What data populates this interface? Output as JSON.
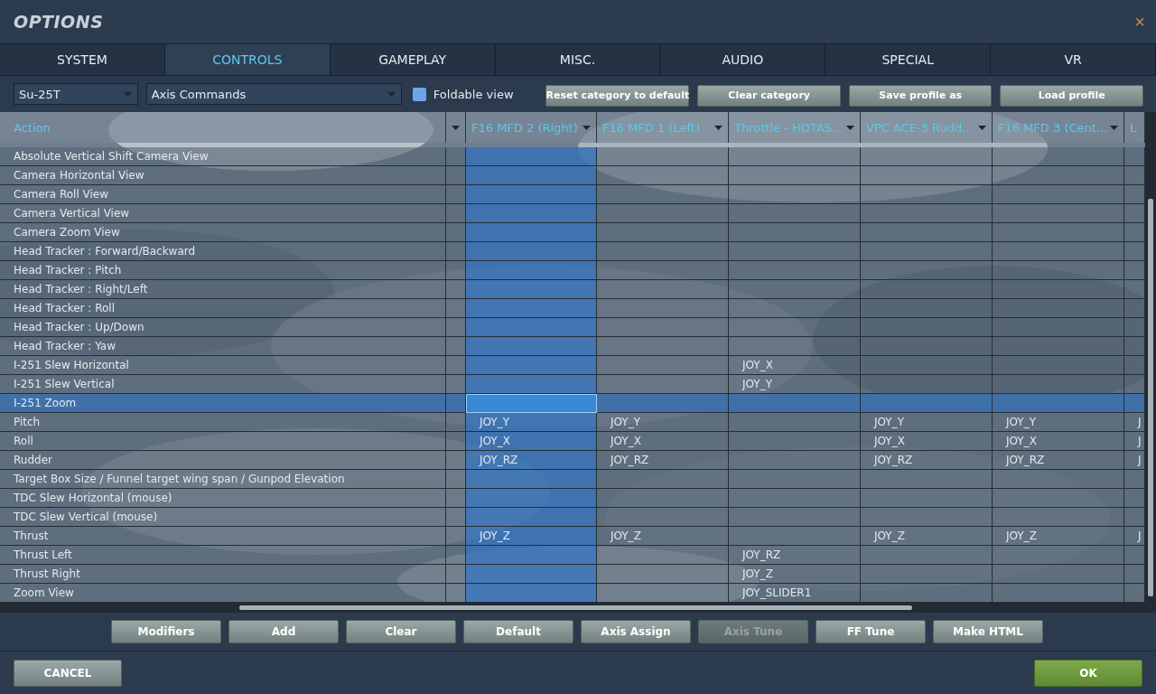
{
  "window": {
    "title": "OPTIONS",
    "close": "×"
  },
  "tabs": [
    {
      "label": "SYSTEM",
      "selected": false
    },
    {
      "label": "CONTROLS",
      "selected": true
    },
    {
      "label": "GAMEPLAY",
      "selected": false
    },
    {
      "label": "MISC.",
      "selected": false
    },
    {
      "label": "AUDIO",
      "selected": false
    },
    {
      "label": "SPECIAL",
      "selected": false
    },
    {
      "label": "VR",
      "selected": false
    }
  ],
  "toolbar": {
    "aircraft": "Su-25T",
    "category": "Axis Commands",
    "foldable_view": {
      "label": "Foldable view",
      "checked": false
    },
    "buttons": [
      "Reset category to default",
      "Clear category",
      "Save profile as",
      "Load profile"
    ]
  },
  "table": {
    "action_header": "Action",
    "columns": [
      {
        "label": "F16 MFD 2 (Right)",
        "selected": true
      },
      {
        "label": "F16 MFD 1 (Left)",
        "selected": false
      },
      {
        "label": "Throttle - HOTAS...",
        "selected": false
      },
      {
        "label": "VPC ACE-3 Rudd...",
        "selected": false
      },
      {
        "label": "F16 MFD 3 (Cent...",
        "selected": false
      },
      {
        "label": "L",
        "selected": false
      }
    ],
    "rows": [
      {
        "action": "Absolute Vertical Shift Camera View",
        "selected": false,
        "cells": [
          null,
          null,
          null,
          null,
          null,
          null
        ]
      },
      {
        "action": "Camera Horizontal View",
        "selected": false,
        "cells": [
          null,
          null,
          null,
          null,
          null,
          null
        ]
      },
      {
        "action": "Camera Roll View",
        "selected": false,
        "cells": [
          null,
          null,
          null,
          null,
          null,
          null
        ]
      },
      {
        "action": "Camera Vertical View",
        "selected": false,
        "cells": [
          null,
          null,
          null,
          null,
          null,
          null
        ]
      },
      {
        "action": "Camera Zoom View",
        "selected": false,
        "cells": [
          null,
          null,
          null,
          null,
          null,
          null
        ]
      },
      {
        "action": "Head Tracker : Forward/Backward",
        "selected": false,
        "cells": [
          null,
          null,
          null,
          null,
          null,
          null
        ]
      },
      {
        "action": "Head Tracker : Pitch",
        "selected": false,
        "cells": [
          null,
          null,
          null,
          null,
          null,
          null
        ]
      },
      {
        "action": "Head Tracker : Right/Left",
        "selected": false,
        "cells": [
          null,
          null,
          null,
          null,
          null,
          null
        ]
      },
      {
        "action": "Head Tracker : Roll",
        "selected": false,
        "cells": [
          null,
          null,
          null,
          null,
          null,
          null
        ]
      },
      {
        "action": "Head Tracker : Up/Down",
        "selected": false,
        "cells": [
          null,
          null,
          null,
          null,
          null,
          null
        ]
      },
      {
        "action": "Head Tracker : Yaw",
        "selected": false,
        "cells": [
          null,
          null,
          null,
          null,
          null,
          null
        ]
      },
      {
        "action": "I-251 Slew Horizontal",
        "selected": false,
        "cells": [
          null,
          null,
          "JOY_X",
          null,
          null,
          null
        ]
      },
      {
        "action": "I-251 Slew Vertical",
        "selected": false,
        "cells": [
          null,
          null,
          "JOY_Y",
          null,
          null,
          null
        ]
      },
      {
        "action": "I-251 Zoom",
        "selected": true,
        "cells": [
          null,
          null,
          null,
          null,
          null,
          null
        ]
      },
      {
        "action": "Pitch",
        "selected": false,
        "cells": [
          "JOY_Y",
          "JOY_Y",
          null,
          "JOY_Y",
          "JOY_Y",
          "J"
        ]
      },
      {
        "action": "Roll",
        "selected": false,
        "cells": [
          "JOY_X",
          "JOY_X",
          null,
          "JOY_X",
          "JOY_X",
          "J"
        ]
      },
      {
        "action": "Rudder",
        "selected": false,
        "cells": [
          "JOY_RZ",
          "JOY_RZ",
          null,
          "JOY_RZ",
          "JOY_RZ",
          "J"
        ]
      },
      {
        "action": "Target Box Size / Funnel target wing span / Gunpod Elevation",
        "selected": false,
        "cells": [
          null,
          null,
          null,
          null,
          null,
          null
        ]
      },
      {
        "action": "TDC Slew Horizontal (mouse)",
        "selected": false,
        "cells": [
          null,
          null,
          null,
          null,
          null,
          null
        ]
      },
      {
        "action": "TDC Slew Vertical (mouse)",
        "selected": false,
        "cells": [
          null,
          null,
          null,
          null,
          null,
          null
        ]
      },
      {
        "action": "Thrust",
        "selected": false,
        "cells": [
          "JOY_Z",
          "JOY_Z",
          null,
          "JOY_Z",
          "JOY_Z",
          "J"
        ]
      },
      {
        "action": "Thrust Left",
        "selected": false,
        "cells": [
          null,
          null,
          "JOY_RZ",
          null,
          null,
          null
        ]
      },
      {
        "action": "Thrust Right",
        "selected": false,
        "cells": [
          null,
          null,
          "JOY_Z",
          null,
          null,
          null
        ]
      },
      {
        "action": "Zoom View",
        "selected": false,
        "cells": [
          null,
          null,
          "JOY_SLIDER1",
          null,
          null,
          null
        ]
      }
    ]
  },
  "action_buttons": [
    {
      "label": "Modifiers",
      "disabled": false
    },
    {
      "label": "Add",
      "disabled": false
    },
    {
      "label": "Clear",
      "disabled": false
    },
    {
      "label": "Default",
      "disabled": false
    },
    {
      "label": "Axis Assign",
      "disabled": false
    },
    {
      "label": "Axis Tune",
      "disabled": true
    },
    {
      "label": "FF Tune",
      "disabled": false
    },
    {
      "label": "Make HTML",
      "disabled": false
    }
  ],
  "footer": {
    "cancel": "CANCEL",
    "ok": "OK"
  }
}
